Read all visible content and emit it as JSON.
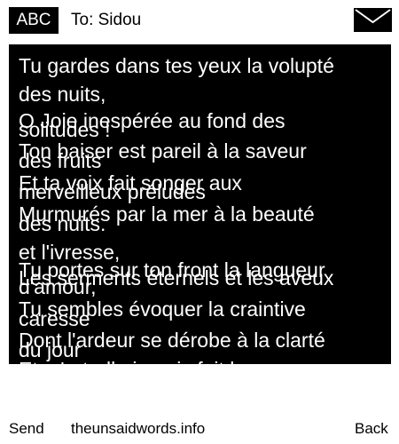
{
  "header": {
    "input_mode": "ABC",
    "to_line": "To: Sidou",
    "mail_icon": "envelope-icon"
  },
  "message": {
    "lines": [
      "Tu gardes dans tes yeux la volupté",
      "des nuits,",
      "O Joie inespérée au fond des",
      "solitudes !",
      "Ton baiser est pareil à la saveur",
      "des fruits",
      "Et ta voix fait songer aux",
      "merveilleux préludes",
      "Murmurés par la mer à la beauté",
      "des nuits.",
      "et l'ivresse,",
      "Tu portes sur ton front la langueur",
      "Les serments éternels et les aveux",
      "d'amour,",
      "Tu sembles évoquer la craintive",
      "caresse",
      "Dont l'ardeur se dérobe à la clarté",
      "du jour",
      "Et m'a-t-elle jamais fait le"
    ]
  },
  "footer": {
    "send_label": "Send",
    "site_label": "theunsaidwords.info",
    "back_label": "Back"
  },
  "colors": {
    "background": "#ffffff",
    "text_box": "#000000",
    "text_on_dark": "#ffffff"
  }
}
